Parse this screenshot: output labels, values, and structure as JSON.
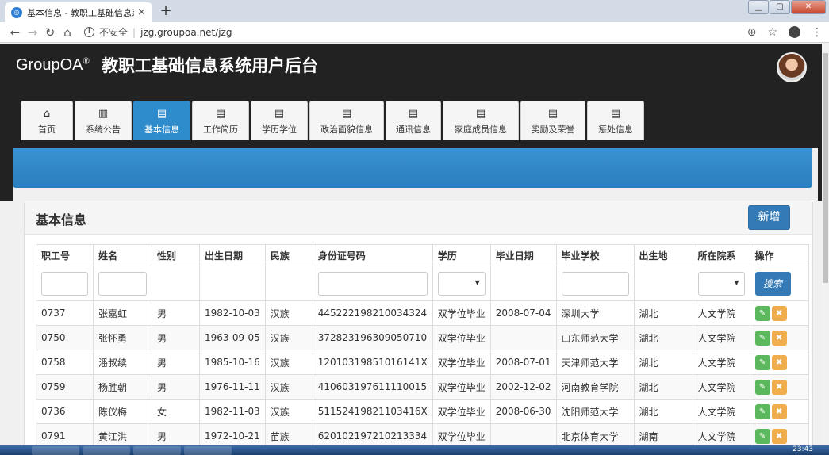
{
  "browser": {
    "tab_title": "基本信息 - 教职工基础信息系统",
    "tab_close": "×",
    "new_tab": "+",
    "insecure_label": "不安全",
    "url": "jzg.groupoa.net/jzg"
  },
  "header": {
    "brand": "GroupOA",
    "brand_mark": "®",
    "title": "教职工基础信息系统用户后台"
  },
  "nav": {
    "tabs": [
      {
        "label": "首页",
        "icon": "home-icon"
      },
      {
        "label": "系统公告",
        "icon": "chart-icon"
      },
      {
        "label": "基本信息",
        "icon": "book-icon",
        "active": true
      },
      {
        "label": "工作简历",
        "icon": "book-icon"
      },
      {
        "label": "学历学位",
        "icon": "book-icon"
      },
      {
        "label": "政治面貌信息",
        "icon": "book-icon"
      },
      {
        "label": "通讯信息",
        "icon": "book-icon"
      },
      {
        "label": "家庭成员信息",
        "icon": "book-icon"
      },
      {
        "label": "奖励及荣誉",
        "icon": "book-icon"
      },
      {
        "label": "惩处信息",
        "icon": "book-icon"
      }
    ]
  },
  "panel": {
    "title": "基本信息",
    "add_label": "新增",
    "search_label": "搜索"
  },
  "table": {
    "headers": [
      "职工号",
      "姓名",
      "性别",
      "出生日期",
      "民族",
      "身份证号码",
      "学历",
      "毕业日期",
      "毕业学校",
      "出生地",
      "所在院系",
      "操作"
    ],
    "rows": [
      [
        "0737",
        "张嘉虹",
        "男",
        "1982-10-03",
        "汉族",
        "445222198210034324",
        "双学位毕业",
        "2008-07-04",
        "深圳大学",
        "湖北",
        "人文学院"
      ],
      [
        "0750",
        "张怀勇",
        "男",
        "1963-09-05",
        "汉族",
        "372823196309050710",
        "双学位毕业",
        "",
        "山东师范大学",
        "湖北",
        "人文学院"
      ],
      [
        "0758",
        "潘叔续",
        "男",
        "1985-10-16",
        "汉族",
        "12010319851016141X",
        "双学位毕业",
        "2008-07-01",
        "天津师范大学",
        "湖北",
        "人文学院"
      ],
      [
        "0759",
        "杨胜朝",
        "男",
        "1976-11-11",
        "汉族",
        "410603197611110015",
        "双学位毕业",
        "2002-12-02",
        "河南教育学院",
        "湖北",
        "人文学院"
      ],
      [
        "0736",
        "陈仪梅",
        "女",
        "1982-11-03",
        "汉族",
        "51152419821103416X",
        "双学位毕业",
        "2008-06-30",
        "沈阳师范大学",
        "湖北",
        "人文学院"
      ],
      [
        "0791",
        "黄江洪",
        "男",
        "1972-10-21",
        "苗族",
        "620102197210213334",
        "双学位毕业",
        "",
        "北京体育大学",
        "湖南",
        "人文学院"
      ]
    ]
  },
  "taskbar": {
    "clock": "23:43"
  },
  "colors": {
    "primary": "#337ab7",
    "active_tab": "#2e8bcc",
    "header_bg": "#222222",
    "edit": "#5cb85c",
    "delete": "#f0ad4e"
  }
}
